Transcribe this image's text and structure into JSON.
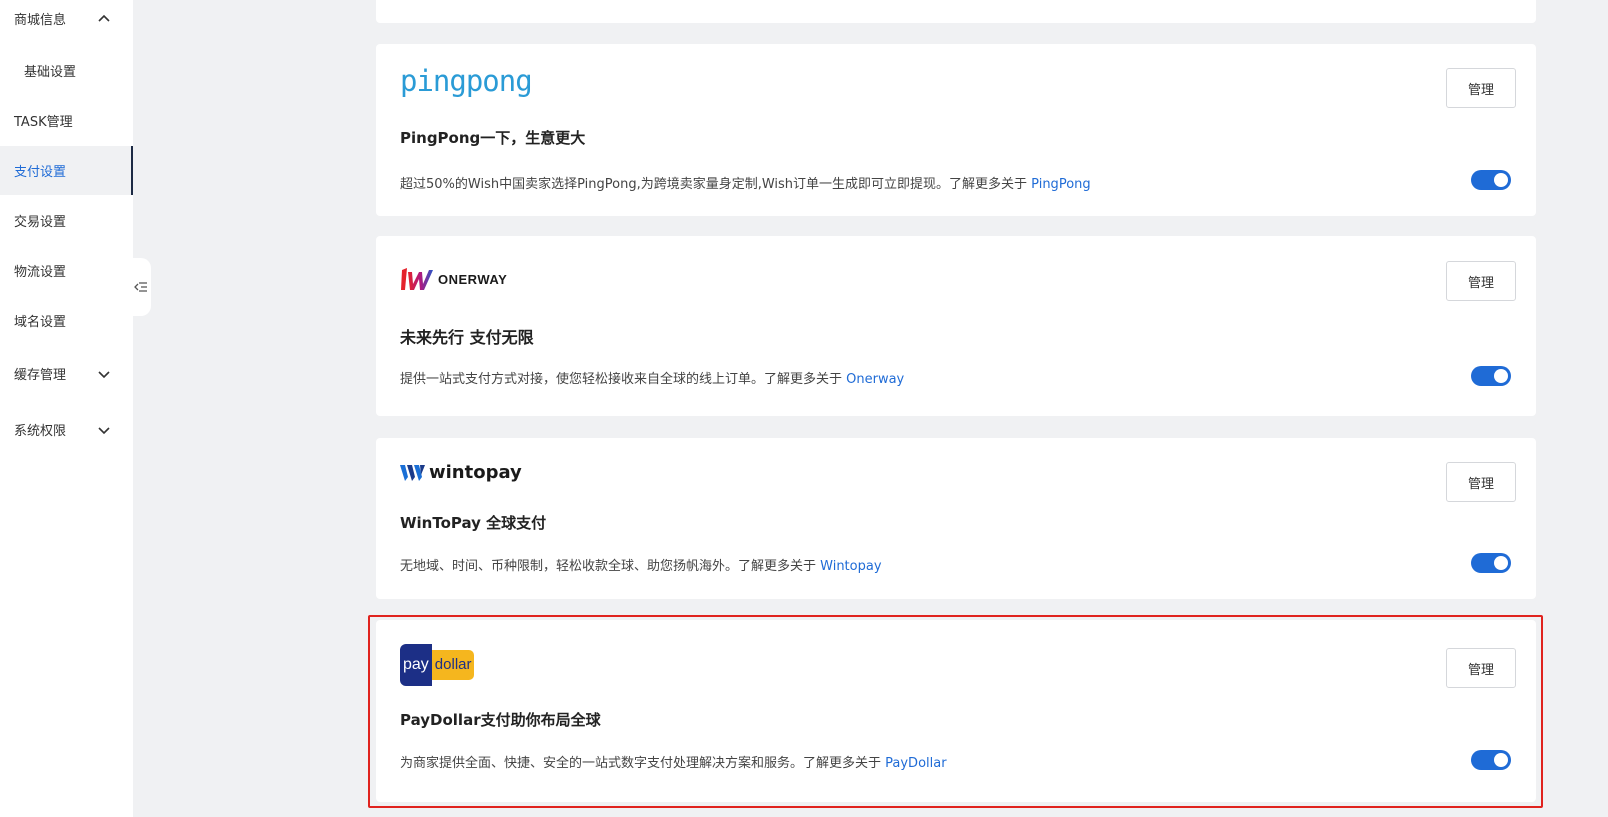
{
  "sidebar": {
    "items": [
      {
        "label": "商城信息"
      },
      {
        "label": "基础设置"
      },
      {
        "label": "TASK管理"
      },
      {
        "label": "支付设置"
      },
      {
        "label": "交易设置"
      },
      {
        "label": "物流设置"
      },
      {
        "label": "域名设置"
      },
      {
        "label": "缓存管理"
      },
      {
        "label": "系统权限"
      }
    ],
    "active_color": "#1f6bd6"
  },
  "cards": [
    {
      "logo_text": "pingpong",
      "title": "PingPong一下，生意更大",
      "desc": "超过50%的Wish中国卖家选择PingPong,为跨境卖家量身定制,Wish订单一生成即可立即提现。了解更多关于 ",
      "link": "PingPong",
      "manage_label": "管理",
      "enabled": true
    },
    {
      "logo_text": "ONERWAY",
      "title": "未来先行 支付无限",
      "desc": "提供一站式支付方式对接，使您轻松接收来自全球的线上订单。了解更多关于 ",
      "link": "Onerway",
      "manage_label": "管理",
      "enabled": true
    },
    {
      "logo_text": "wintopay",
      "title": "WinToPay 全球支付",
      "desc": "无地域、时间、币种限制，轻松收款全球、助您扬帆海外。了解更多关于 ",
      "link": "Wintopay",
      "manage_label": "管理",
      "enabled": true
    },
    {
      "logo_text_1": "pay",
      "logo_text_2": "dollar",
      "title": "PayDollar支付助你布局全球",
      "desc": "为商家提供全面、快捷、安全的一站式数字支付处理解决方案和服务。了解更多关于 ",
      "link": "PayDollar",
      "manage_label": "管理",
      "enabled": true
    }
  ],
  "colors": {
    "toggle_on": "#1f6bd6",
    "link": "#1f6bd6",
    "highlight": "#e0231e"
  }
}
